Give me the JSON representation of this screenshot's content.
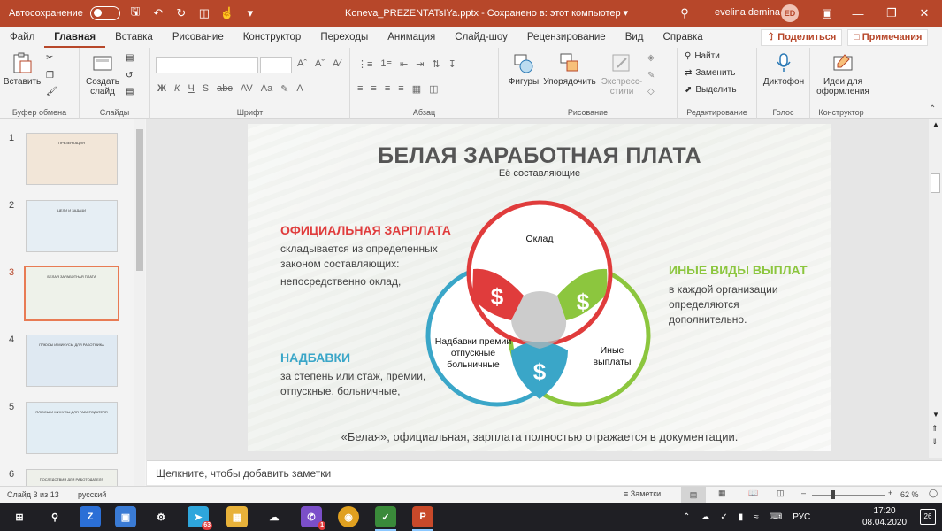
{
  "titlebar": {
    "autosave": "Автосохранение",
    "doc_title": "Koneva_PREZENTATsIYa.pptx  -  Сохранено в: этот компьютер ▾",
    "user_name": "evelina demina",
    "avatar": "ED"
  },
  "tabs": [
    "Файл",
    "Главная",
    "Вставка",
    "Рисование",
    "Конструктор",
    "Переходы",
    "Анимация",
    "Слайд-шоу",
    "Рецензирование",
    "Вид",
    "Справка"
  ],
  "share_label": "Поделиться",
  "notes_button_label": "Примечания",
  "ribbon": {
    "clipboard": {
      "paste": "Вставить",
      "label": "Буфер обмена"
    },
    "slides": {
      "create": "Создать слайд",
      "label": "Слайды"
    },
    "font": {
      "label": "Шрифт"
    },
    "paragraph": {
      "label": "Абзац"
    },
    "drawing": {
      "shapes": "Фигуры",
      "arrange": "Упорядочить",
      "styles": "Экспресс-стили",
      "label": "Рисование"
    },
    "editing": {
      "find": "Найти",
      "replace": "Заменить",
      "select": "Выделить",
      "label": "Редактирование"
    },
    "voice": {
      "dictate": "Диктофон",
      "label": "Голос"
    },
    "designer": {
      "ideas": "Идеи для оформления",
      "label": "Конструктор"
    }
  },
  "thumbnails": [
    {
      "num": "1",
      "title": "ПРЕЗЕНТАЦИЯ"
    },
    {
      "num": "2",
      "title": "ЦЕЛИ И ЗАДАЧИ"
    },
    {
      "num": "3",
      "title": "БЕЛАЯ ЗАРАБОТНАЯ ПЛАТА"
    },
    {
      "num": "4",
      "title": "ПЛЮСЫ И МИНУСЫ ДЛЯ РАБОТНИКА"
    },
    {
      "num": "5",
      "title": "ПЛЮСЫ И МИНУСЫ ДЛЯ РАБОТОДАТЕЛЯ"
    },
    {
      "num": "6",
      "title": "ПОСЛЕДСТВИЯ ДЛЯ РАБОТОДАТЕЛЯ"
    }
  ],
  "slide": {
    "title": "БЕЛАЯ ЗАРАБОТНАЯ ПЛАТА",
    "subtitle": "Её составляющие",
    "official_heading": "ОФИЦИАЛЬНАЯ ЗАРПЛАТА",
    "official_text1": "складывается из определенных законом составляющих:",
    "official_text2": "непосредственно оклад,",
    "bonus_heading": "НАДБАВКИ",
    "bonus_text": "за степень или стаж, премии, отпускные, больничные,",
    "other_heading": "ИНЫЕ ВИДЫ ВЫПЛАТ",
    "other_text": "в каждой организации определяются дополнительно.",
    "venn_top": "Оклад",
    "venn_left": "Надбавки премии отпускные больничные",
    "venn_right": "Иные выплаты",
    "footer": "«Белая», официальная, зарплата полностью отражается в документации.",
    "colors": {
      "red": "#e03c3c",
      "green": "#8cc63e",
      "blue": "#3aa6c8",
      "title": "#555555"
    }
  },
  "notes_placeholder": "Щелкните, чтобы добавить заметки",
  "status": {
    "slide_of": "Слайд 3 из 13",
    "language": "русский",
    "notes": "Заметки",
    "zoom": "62 %"
  },
  "taskbar": {
    "lang": "РУС",
    "time": "17:20",
    "date": "08.04.2020",
    "notif_count": "26",
    "telegram_badge": "63",
    "viber_badge": "1"
  }
}
